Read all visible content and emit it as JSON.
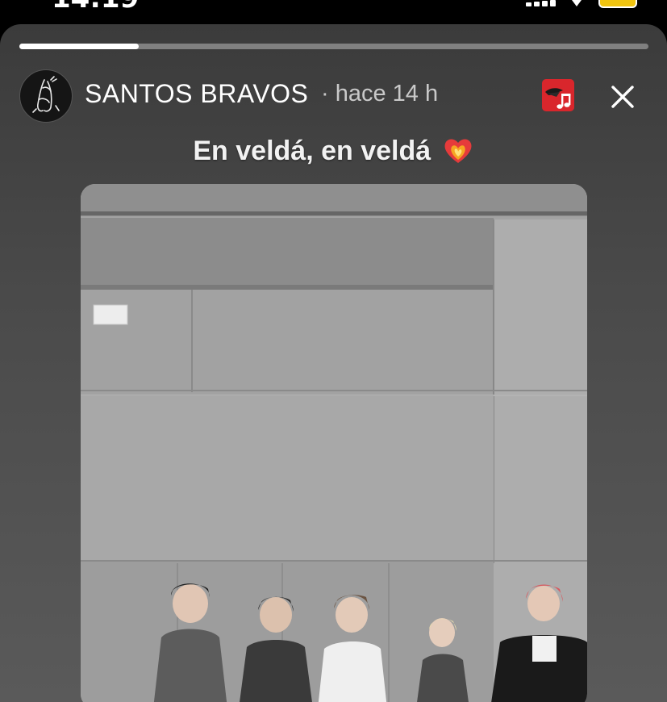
{
  "status_bar": {
    "time": "14:19"
  },
  "story": {
    "progress": 0.19,
    "account_name": "SANTOS BRAVOS",
    "time_ago": "· hace 14 h",
    "caption": "En veldá, en veldá"
  },
  "icons": {
    "avatar": "monochrome-illustration-avatar",
    "music": "music-note-icon",
    "close": "close-icon",
    "caption_emoji": "mending-heart-on-fire-emoji"
  },
  "colors": {
    "card_background": "#444444",
    "music_badge": "#d9262c",
    "progress_fill": "#ffffff"
  }
}
